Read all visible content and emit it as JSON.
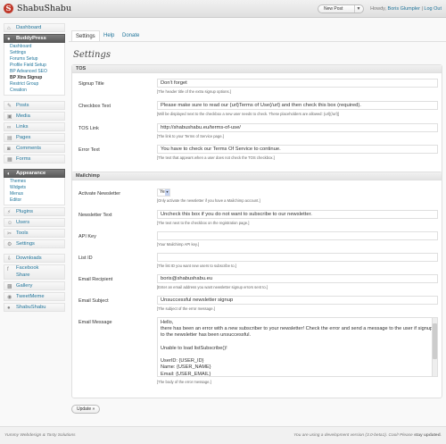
{
  "header": {
    "site_title": "ShabuShabu",
    "logo_letter": "S",
    "new_post": "New Post",
    "howdy_prefix": "Howdy,",
    "user": "Boris Glumpler",
    "separator": "|",
    "logout": "Log Out"
  },
  "sidebar": {
    "dashboard": "Dashboard",
    "buddypress": "BuddyPress",
    "buddypress_sub": [
      "Dashboard",
      "Settings",
      "Forums Setup",
      "Profile Field Setup",
      "BP Advanced SEO",
      "BP Xtra Signup",
      "Restrict Group Creation"
    ],
    "posts": "Posts",
    "media": "Media",
    "links": "Links",
    "pages": "Pages",
    "comments": "Comments",
    "forms": "Forms",
    "appearance": "Appearance",
    "appearance_sub": [
      "Themes",
      "Widgets",
      "Menus",
      "Editor"
    ],
    "plugins": "Plugins",
    "users": "Users",
    "tools": "Tools",
    "settings": "Settings",
    "downloads": "Downloads",
    "facebook_share": "Facebook Share",
    "gallery": "Gallery",
    "tweetmeme": "TweetMeme",
    "shabushabu": "ShabuShabu"
  },
  "tabs": {
    "settings": "Settings",
    "help": "Help",
    "donate": "Donate"
  },
  "page_title": "Settings",
  "tos": {
    "heading": "TOS",
    "signup_title_label": "Signup Title",
    "signup_title_value": "Don't forget",
    "signup_title_desc": "[The header title of the extra signup options.]",
    "checkbox_label": "Checkbox Text",
    "checkbox_value": "Please make sure to read our {url}Terms of Use{/url} and then check this box (required).",
    "checkbox_desc": "[Will be displayed next to the checkbox a new user needs to check. These placeholders are allowed: {url}{/url}]",
    "link_label": "TOS Link",
    "link_value": "http://shabushabu.eu/terms-of-use/",
    "link_desc": "[The link to your Terms of Service page.]",
    "error_label": "Error Text",
    "error_value": "You have to check our Terms Of Service to continue.",
    "error_desc": "[The text that appears when a user does not check the TOS checkbox.]"
  },
  "mailchimp": {
    "heading": "Mailchimp",
    "activate_label": "Activate Newsletter",
    "activate_value": "Yes",
    "activate_desc": "[Only activate the newsletter if you have a Mailchimp account.]",
    "newsletter_label": "Newsletter Text",
    "newsletter_value": "Uncheck this box if you do not want to subscribe to our newsletter.",
    "newsletter_desc": "[The text next to the checkbox on the registration page.]",
    "apikey_label": "API Key",
    "apikey_value": "",
    "apikey_desc": "[Your Mailchimp API key.]",
    "listid_label": "List ID",
    "listid_value": "",
    "listid_desc": "[The list ID you want new users to subscribe to.]",
    "recipient_label": "Email Recipient",
    "recipient_value": "boris@shabushabu.eu",
    "recipient_desc": "[Enter an email address you want newsletter signup errors sent to.]",
    "subject_label": "Email Subject",
    "subject_value": "Unsuccessful newsletter signup",
    "subject_desc": "[The subject of the error message.]",
    "message_label": "Email Message",
    "message_value": "Hello,\nthere has been an error with a new subscriber to your newsletter! Check the error and send a message to the user if signup to the newsletter has been unsuccessful.\n\nUnable to load listSubscribe()!\n\nUserID: {USER_ID}\nName: {USER_NAME}\nEmail: {USER_EMAIL}",
    "message_desc": "[The body of the error message.]"
  },
  "update_button": "Update »",
  "footer": {
    "left": "Yummy Webdesign & Tasty Solutions",
    "right_text": "You are using a development version (3.0-beta1). Cool! Please ",
    "right_bold": "stay updated",
    "right_end": "."
  }
}
